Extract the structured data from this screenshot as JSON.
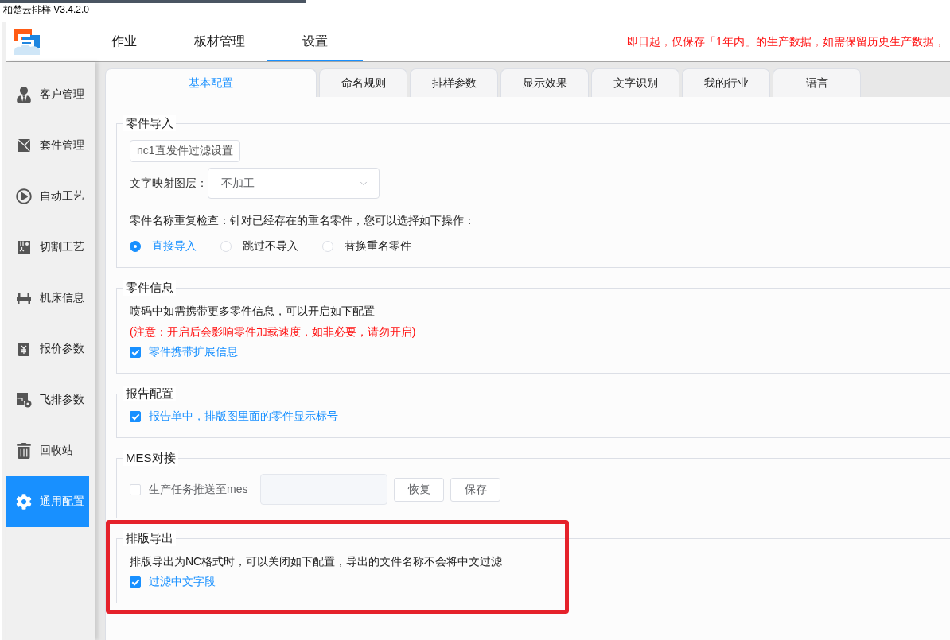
{
  "window": {
    "title": "柏楚云排样 V3.4.2.0"
  },
  "header": {
    "nav": [
      {
        "label": "作业",
        "selected": false
      },
      {
        "label": "板材管理",
        "selected": false
      },
      {
        "label": "设置",
        "selected": true
      }
    ],
    "notice": "即日起，仅保存「1年内」的生产数据，如需保留历史生产数据，"
  },
  "sidebar": {
    "items": [
      {
        "label": "客户管理",
        "selected": false
      },
      {
        "label": "套件管理",
        "selected": false
      },
      {
        "label": "自动工艺",
        "selected": false
      },
      {
        "label": "切割工艺",
        "selected": false
      },
      {
        "label": "机床信息",
        "selected": false
      },
      {
        "label": "报价参数",
        "selected": false
      },
      {
        "label": "飞排参数",
        "selected": false
      },
      {
        "label": "回收站",
        "selected": false
      },
      {
        "label": "通用配置",
        "selected": true
      }
    ]
  },
  "tabs": [
    {
      "label": "基本配置",
      "selected": true
    },
    {
      "label": "命名规则",
      "selected": false
    },
    {
      "label": "排样参数",
      "selected": false
    },
    {
      "label": "显示效果",
      "selected": false
    },
    {
      "label": "文字识别",
      "selected": false
    },
    {
      "label": "我的行业",
      "selected": false
    },
    {
      "label": "语言",
      "selected": false
    }
  ],
  "sections": [
    {
      "title": "零件导入",
      "highlighted": false,
      "rows": [
        {
          "kind": "button",
          "label": "nc1直发件过滤设置"
        },
        {
          "kind": "select",
          "label": "文字映射图层：",
          "value": "不加工"
        },
        {
          "kind": "text",
          "text": "零件名称重复检查：针对已经存在的重名零件，您可以选择如下操作："
        },
        {
          "kind": "radios",
          "options": [
            {
              "label": "直接导入",
              "selected": true
            },
            {
              "label": "跳过不导入",
              "selected": false
            },
            {
              "label": "替换重名零件",
              "selected": false
            }
          ]
        }
      ]
    },
    {
      "title": "零件信息",
      "highlighted": false,
      "rows": [
        {
          "kind": "text",
          "text": "喷码中如需携带更多零件信息，可以开启如下配置"
        },
        {
          "kind": "warning",
          "text": "(注意：开启后会影响零件加载速度，如非必要，请勿开启)"
        },
        {
          "kind": "checkbox",
          "label": "零件携带扩展信息",
          "checked": true
        }
      ]
    },
    {
      "title": "报告配置",
      "highlighted": false,
      "rows": [
        {
          "kind": "checkbox",
          "label": "报告单中，排版图里面的零件显示标号",
          "checked": true
        }
      ]
    },
    {
      "title": "MES对接",
      "highlighted": false,
      "rows": [
        {
          "kind": "push",
          "label": "生产任务推送至mes",
          "checked": false,
          "buttons": [
            "恢复",
            "保存"
          ]
        }
      ]
    },
    {
      "title": "排版导出",
      "highlighted": true,
      "rows": [
        {
          "kind": "text",
          "text": "排版导出为NC格式时，可以关闭如下配置，导出的文件名称不会将中文过滤"
        },
        {
          "kind": "checkbox",
          "label": "过滤中文字段",
          "checked": true
        }
      ]
    }
  ]
}
